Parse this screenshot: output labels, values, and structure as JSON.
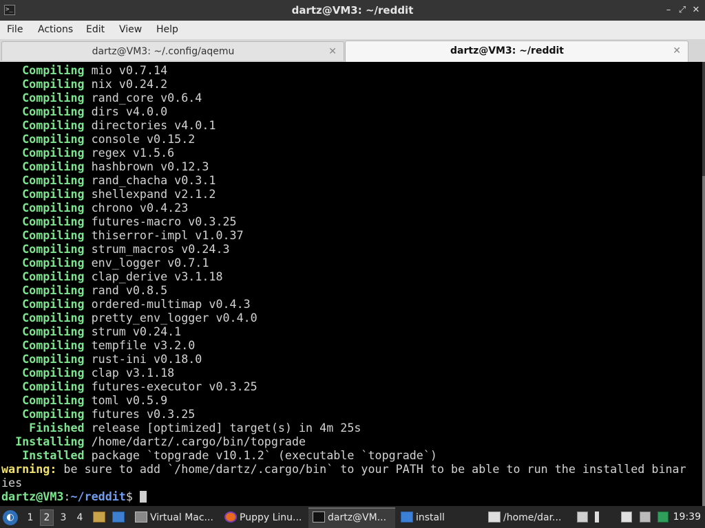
{
  "window": {
    "title": "dartz@VM3: ~/reddit",
    "minimize_glyph": "–",
    "maximize_glyph": "⤢",
    "close_glyph": "✕",
    "app_icon_glyph": ">_"
  },
  "menu": [
    "File",
    "Actions",
    "Edit",
    "View",
    "Help"
  ],
  "tabs": [
    {
      "label": "dartz@VM3: ~/.config/aqemu",
      "close": "✕",
      "active": false
    },
    {
      "label": "dartz@VM3: ~/reddit",
      "close": "✕",
      "active": true
    }
  ],
  "terminal": {
    "status_lines": [
      {
        "status": "   Compiling",
        "text": " mio v0.7.14"
      },
      {
        "status": "   Compiling",
        "text": " nix v0.24.2"
      },
      {
        "status": "   Compiling",
        "text": " rand_core v0.6.4"
      },
      {
        "status": "   Compiling",
        "text": " dirs v4.0.0"
      },
      {
        "status": "   Compiling",
        "text": " directories v4.0.1"
      },
      {
        "status": "   Compiling",
        "text": " console v0.15.2"
      },
      {
        "status": "   Compiling",
        "text": " regex v1.5.6"
      },
      {
        "status": "   Compiling",
        "text": " hashbrown v0.12.3"
      },
      {
        "status": "   Compiling",
        "text": " rand_chacha v0.3.1"
      },
      {
        "status": "   Compiling",
        "text": " shellexpand v2.1.2"
      },
      {
        "status": "   Compiling",
        "text": " chrono v0.4.23"
      },
      {
        "status": "   Compiling",
        "text": " futures-macro v0.3.25"
      },
      {
        "status": "   Compiling",
        "text": " thiserror-impl v1.0.37"
      },
      {
        "status": "   Compiling",
        "text": " strum_macros v0.24.3"
      },
      {
        "status": "   Compiling",
        "text": " env_logger v0.7.1"
      },
      {
        "status": "   Compiling",
        "text": " clap_derive v3.1.18"
      },
      {
        "status": "   Compiling",
        "text": " rand v0.8.5"
      },
      {
        "status": "   Compiling",
        "text": " ordered-multimap v0.4.3"
      },
      {
        "status": "   Compiling",
        "text": " pretty_env_logger v0.4.0"
      },
      {
        "status": "   Compiling",
        "text": " strum v0.24.1"
      },
      {
        "status": "   Compiling",
        "text": " tempfile v3.2.0"
      },
      {
        "status": "   Compiling",
        "text": " rust-ini v0.18.0"
      },
      {
        "status": "   Compiling",
        "text": " clap v3.1.18"
      },
      {
        "status": "   Compiling",
        "text": " futures-executor v0.3.25"
      },
      {
        "status": "   Compiling",
        "text": " toml v0.5.9"
      },
      {
        "status": "   Compiling",
        "text": " futures v0.3.25"
      },
      {
        "status": "    Finished",
        "text": " release [optimized] target(s) in 4m 25s"
      },
      {
        "status": "  Installing",
        "text": " /home/dartz/.cargo/bin/topgrade"
      },
      {
        "status": "   Installed",
        "text": " package `topgrade v10.1.2` (executable `topgrade`)"
      }
    ],
    "warning": {
      "label": "warning:",
      "text": " be sure to add `/home/dartz/.cargo/bin` to your PATH to be able to run the installed binar",
      "wrap": "ies"
    },
    "prompt": {
      "user_host": "dartz@VM3",
      "colon": ":",
      "path": "~/reddit",
      "symbol": "$ "
    }
  },
  "taskbar": {
    "start_glyph": "◐",
    "workspaces": [
      "1",
      "2",
      "3",
      "4"
    ],
    "active_workspace": "2",
    "tasks": [
      {
        "label": "Virtual Mac...",
        "icon": "virtual-machine-icon"
      },
      {
        "label": "Puppy Linu...",
        "icon": "firefox-icon"
      },
      {
        "label": "dartz@VM...",
        "icon": "terminal-icon"
      },
      {
        "label": "install",
        "icon": "folder-icon"
      },
      {
        "label": "/home/dar...",
        "icon": "text-editor-icon"
      }
    ],
    "clock": "19:39"
  },
  "colors": {
    "terminal_bg": "#000000",
    "status_green": "#7ce58e",
    "warning_yellow": "#f0e26b",
    "prompt_blue": "#6f9df0"
  }
}
